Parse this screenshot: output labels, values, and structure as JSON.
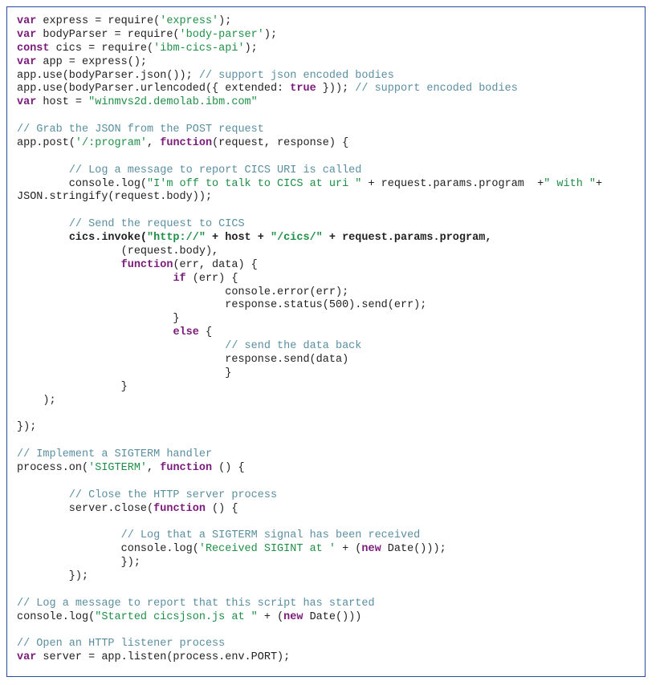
{
  "code": {
    "tokens": [
      [
        {
          "t": "var ",
          "c": "kw"
        },
        {
          "t": "express = require(",
          "c": "plain"
        },
        {
          "t": "'express'",
          "c": "str"
        },
        {
          "t": ");",
          "c": "plain"
        }
      ],
      [
        {
          "t": "var ",
          "c": "kw"
        },
        {
          "t": "bodyParser = require(",
          "c": "plain"
        },
        {
          "t": "'body-parser'",
          "c": "str"
        },
        {
          "t": ");",
          "c": "plain"
        }
      ],
      [
        {
          "t": "const ",
          "c": "kw"
        },
        {
          "t": "cics = require(",
          "c": "plain"
        },
        {
          "t": "'ibm-cics-api'",
          "c": "str"
        },
        {
          "t": ");",
          "c": "plain"
        }
      ],
      [
        {
          "t": "var ",
          "c": "kw"
        },
        {
          "t": "app = express();",
          "c": "plain"
        }
      ],
      [
        {
          "t": "app.use(bodyParser.json()); ",
          "c": "plain"
        },
        {
          "t": "// support json encoded bodies",
          "c": "com"
        }
      ],
      [
        {
          "t": "app.use(bodyParser.urlencoded({ extended: ",
          "c": "plain"
        },
        {
          "t": "true",
          "c": "kw"
        },
        {
          "t": " })); ",
          "c": "plain"
        },
        {
          "t": "// support encoded bodies",
          "c": "com"
        }
      ],
      [
        {
          "t": "var ",
          "c": "kw"
        },
        {
          "t": "host = ",
          "c": "plain"
        },
        {
          "t": "\"winmvs2d.demolab.ibm.com\"",
          "c": "str"
        }
      ],
      [
        {
          "t": "",
          "c": "plain"
        }
      ],
      [
        {
          "t": "// Grab the JSON from the POST request",
          "c": "com"
        }
      ],
      [
        {
          "t": "app.post(",
          "c": "plain"
        },
        {
          "t": "'/:program'",
          "c": "str"
        },
        {
          "t": ", ",
          "c": "plain"
        },
        {
          "t": "function",
          "c": "fnkw"
        },
        {
          "t": "(request, response) {",
          "c": "plain"
        }
      ],
      [
        {
          "t": "",
          "c": "plain"
        }
      ],
      [
        {
          "t": "        ",
          "c": "plain"
        },
        {
          "t": "// Log a message to report CICS URI is called",
          "c": "com"
        }
      ],
      [
        {
          "t": "        console.log(",
          "c": "plain"
        },
        {
          "t": "\"I'm off to talk to CICS at uri \"",
          "c": "str"
        },
        {
          "t": " + request.params.program  +",
          "c": "plain"
        },
        {
          "t": "\" with \"",
          "c": "str"
        },
        {
          "t": "+ ",
          "c": "plain"
        }
      ],
      [
        {
          "t": "JSON.stringify(request.body));",
          "c": "plain"
        }
      ],
      [
        {
          "t": "",
          "c": "plain"
        }
      ],
      [
        {
          "t": "        ",
          "c": "plain"
        },
        {
          "t": "// Send the request to CICS",
          "c": "com"
        }
      ],
      [
        {
          "t": "        ",
          "c": "plain"
        },
        {
          "t": "cics.invoke(",
          "c": "bold"
        },
        {
          "t": "\"http://\"",
          "c": "str bold"
        },
        {
          "t": " + host + ",
          "c": "bold"
        },
        {
          "t": "\"/cics/\"",
          "c": "str bold"
        },
        {
          "t": " + request.params.program,",
          "c": "bold"
        }
      ],
      [
        {
          "t": "                (request.body),",
          "c": "plain"
        }
      ],
      [
        {
          "t": "                ",
          "c": "plain"
        },
        {
          "t": "function",
          "c": "fnkw"
        },
        {
          "t": "(err, data) {",
          "c": "plain"
        }
      ],
      [
        {
          "t": "                        ",
          "c": "plain"
        },
        {
          "t": "if",
          "c": "kw"
        },
        {
          "t": " (err) {",
          "c": "plain"
        }
      ],
      [
        {
          "t": "                                console.error(err);",
          "c": "plain"
        }
      ],
      [
        {
          "t": "                                response.status(500).send(err);",
          "c": "plain"
        }
      ],
      [
        {
          "t": "                        }",
          "c": "plain"
        }
      ],
      [
        {
          "t": "                        ",
          "c": "plain"
        },
        {
          "t": "else",
          "c": "kw"
        },
        {
          "t": " {",
          "c": "plain"
        }
      ],
      [
        {
          "t": "                                ",
          "c": "plain"
        },
        {
          "t": "// send the data back",
          "c": "com"
        }
      ],
      [
        {
          "t": "                                response.send(data)",
          "c": "plain"
        }
      ],
      [
        {
          "t": "                                }",
          "c": "plain"
        }
      ],
      [
        {
          "t": "                }",
          "c": "plain"
        }
      ],
      [
        {
          "t": "    );",
          "c": "plain"
        }
      ],
      [
        {
          "t": "",
          "c": "plain"
        }
      ],
      [
        {
          "t": "});",
          "c": "plain"
        }
      ],
      [
        {
          "t": "",
          "c": "plain"
        }
      ],
      [
        {
          "t": "// Implement a SIGTERM handler",
          "c": "com"
        }
      ],
      [
        {
          "t": "process.on(",
          "c": "plain"
        },
        {
          "t": "'SIGTERM'",
          "c": "str"
        },
        {
          "t": ", ",
          "c": "plain"
        },
        {
          "t": "function",
          "c": "fnkw"
        },
        {
          "t": " () {",
          "c": "plain"
        }
      ],
      [
        {
          "t": "",
          "c": "plain"
        }
      ],
      [
        {
          "t": "        ",
          "c": "plain"
        },
        {
          "t": "// Close the HTTP server process",
          "c": "com"
        }
      ],
      [
        {
          "t": "        server.close(",
          "c": "plain"
        },
        {
          "t": "function",
          "c": "fnkw"
        },
        {
          "t": " () {",
          "c": "plain"
        }
      ],
      [
        {
          "t": "",
          "c": "plain"
        }
      ],
      [
        {
          "t": "                ",
          "c": "plain"
        },
        {
          "t": "// Log that a SIGTERM signal has been received",
          "c": "com"
        }
      ],
      [
        {
          "t": "                console.log(",
          "c": "plain"
        },
        {
          "t": "'Received SIGINT at '",
          "c": "str"
        },
        {
          "t": " + (",
          "c": "plain"
        },
        {
          "t": "new",
          "c": "kw"
        },
        {
          "t": " Date()));",
          "c": "plain"
        }
      ],
      [
        {
          "t": "                });",
          "c": "plain"
        }
      ],
      [
        {
          "t": "        });",
          "c": "plain"
        }
      ],
      [
        {
          "t": "",
          "c": "plain"
        }
      ],
      [
        {
          "t": "// Log a message to report that this script has started",
          "c": "com"
        }
      ],
      [
        {
          "t": "console.log(",
          "c": "plain"
        },
        {
          "t": "\"Started cicsjson.js at \"",
          "c": "str"
        },
        {
          "t": " + (",
          "c": "plain"
        },
        {
          "t": "new",
          "c": "kw"
        },
        {
          "t": " Date()))",
          "c": "plain"
        }
      ],
      [
        {
          "t": "",
          "c": "plain"
        }
      ],
      [
        {
          "t": "// Open an HTTP listener process",
          "c": "com"
        }
      ],
      [
        {
          "t": "var ",
          "c": "kw"
        },
        {
          "t": "server = app.listen(process.env.PORT);",
          "c": "plain"
        }
      ]
    ]
  }
}
